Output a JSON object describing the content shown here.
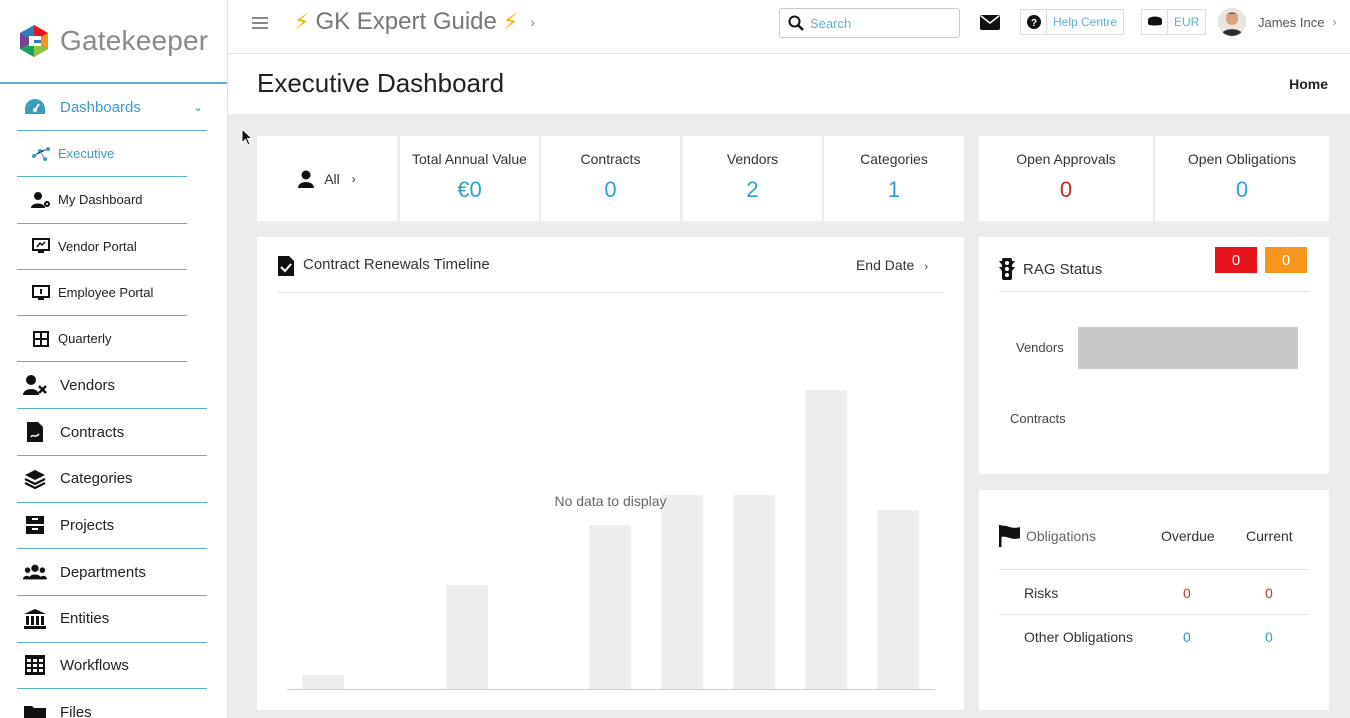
{
  "app": {
    "brand": "Gatekeeper"
  },
  "sidebar": {
    "dashboards_label": "Dashboards",
    "sub_items": [
      {
        "label": "Executive",
        "icon": "network-icon"
      },
      {
        "label": "My Dashboard",
        "icon": "user-gear-icon"
      },
      {
        "label": "Vendor Portal",
        "icon": "monitor-icon"
      },
      {
        "label": "Employee Portal",
        "icon": "monitor-icon"
      },
      {
        "label": "Quarterly",
        "icon": "grid-icon"
      }
    ],
    "items": [
      {
        "label": "Vendors",
        "icon": "user-tools-icon"
      },
      {
        "label": "Contracts",
        "icon": "document-icon"
      },
      {
        "label": "Categories",
        "icon": "layers-icon"
      },
      {
        "label": "Projects",
        "icon": "archive-icon"
      },
      {
        "label": "Departments",
        "icon": "users-icon"
      },
      {
        "label": "Entities",
        "icon": "bank-icon"
      },
      {
        "label": "Workflows",
        "icon": "table-icon"
      },
      {
        "label": "Files",
        "icon": "folder-icon"
      }
    ]
  },
  "topbar": {
    "guide_title": "GK Expert Guide",
    "search_placeholder": "Search",
    "help_label": "Help Centre",
    "currency": "EUR",
    "user_name": "James Ince"
  },
  "page": {
    "title": "Executive Dashboard",
    "breadcrumb": "Home"
  },
  "stats": {
    "filter_label": "All",
    "items": [
      {
        "label": "Total Annual Value",
        "value": "€0"
      },
      {
        "label": "Contracts",
        "value": "0"
      },
      {
        "label": "Vendors",
        "value": "2"
      },
      {
        "label": "Categories",
        "value": "1"
      }
    ],
    "open_approvals": {
      "label": "Open Approvals",
      "value": "0"
    },
    "open_obligations": {
      "label": "Open Obligations",
      "value": "0"
    }
  },
  "timeline": {
    "title": "Contract Renewals Timeline",
    "sort_label": "End Date",
    "no_data": "No data to display"
  },
  "rag": {
    "title": "RAG Status",
    "red_count": "0",
    "amber_count": "0",
    "rows": [
      "Vendors",
      "Contracts"
    ],
    "colors": {
      "red": "#e8141c",
      "amber": "#f7951d"
    }
  },
  "obligations": {
    "title": "Obligations",
    "col_overdue": "Overdue",
    "col_current": "Current",
    "rows": [
      {
        "label": "Risks",
        "overdue": "0",
        "current": "0"
      },
      {
        "label": "Other Obligations",
        "overdue": "0",
        "current": "0"
      }
    ]
  },
  "colors": {
    "accent": "#3a9ec0",
    "value_blue": "#2e9fcb",
    "value_red": "#c62828"
  }
}
